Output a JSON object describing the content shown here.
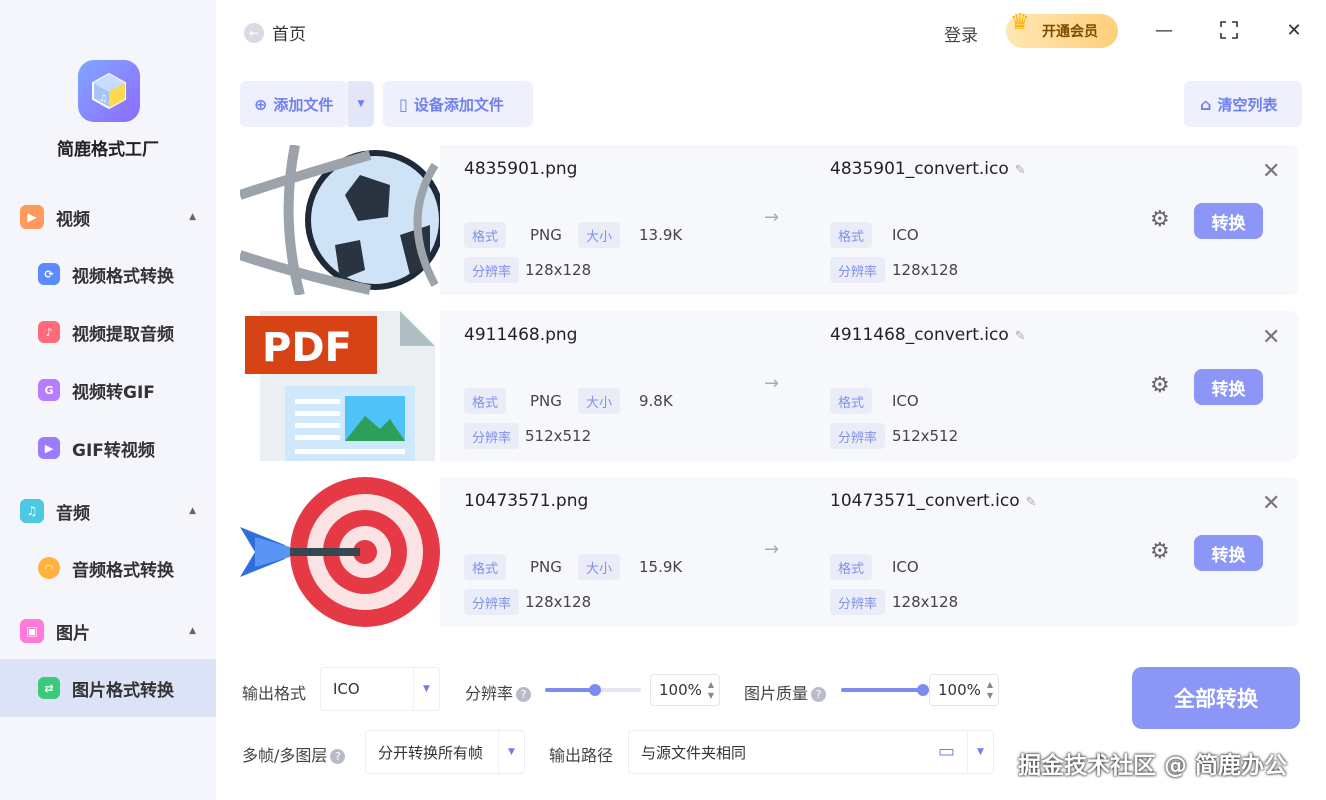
{
  "sidebar": {
    "app_name": "简鹿格式工厂",
    "categories": [
      {
        "label": "视频",
        "items": [
          "视频格式转换",
          "视频提取音频",
          "视频转GIF",
          "GIF转视频"
        ]
      },
      {
        "label": "音频",
        "items": [
          "音频格式转换"
        ]
      },
      {
        "label": "图片",
        "items": [
          "图片格式转换"
        ]
      }
    ],
    "active_item": "图片格式转换"
  },
  "header": {
    "back_label": "首页",
    "login_label": "登录",
    "vip_label": "开通会员",
    "vip_badge": "VIP"
  },
  "toolbar": {
    "add_file": "添加文件",
    "device_add": "设备添加文件",
    "clear_list": "清空列表"
  },
  "labels": {
    "format": "格式",
    "size": "大小",
    "resolution": "分辨率",
    "convert": "转换"
  },
  "files": [
    {
      "name": "4835901.png",
      "out_name": "4835901_convert.ico",
      "format": "PNG",
      "size": "13.9K",
      "resolution": "128x128",
      "out_format": "ICO",
      "out_resolution": "128x128"
    },
    {
      "name": "4911468.png",
      "out_name": "4911468_convert.ico",
      "format": "PNG",
      "size": "9.8K",
      "resolution": "512x512",
      "out_format": "ICO",
      "out_resolution": "512x512"
    },
    {
      "name": "10473571.png",
      "out_name": "10473571_convert.ico",
      "format": "PNG",
      "size": "15.9K",
      "resolution": "128x128",
      "out_format": "ICO",
      "out_resolution": "128x128"
    }
  ],
  "bottom": {
    "output_format_label": "输出格式",
    "output_format_value": "ICO",
    "resolution_label": "分辨率",
    "resolution_value": "100%",
    "quality_label": "图片质量",
    "quality_value": "100%",
    "multiframe_label": "多帧/多图层",
    "multiframe_value": "分开转换所有帧",
    "output_path_label": "输出路径",
    "output_path_value": "与源文件夹相同",
    "convert_all": "全部转换"
  },
  "watermark": "掘金技术社区 @ 简鹿办公",
  "colors": {
    "accent": "#8b96f6",
    "sidebar_bg": "#f4f6fb",
    "active_bg": "#dde3f6"
  }
}
